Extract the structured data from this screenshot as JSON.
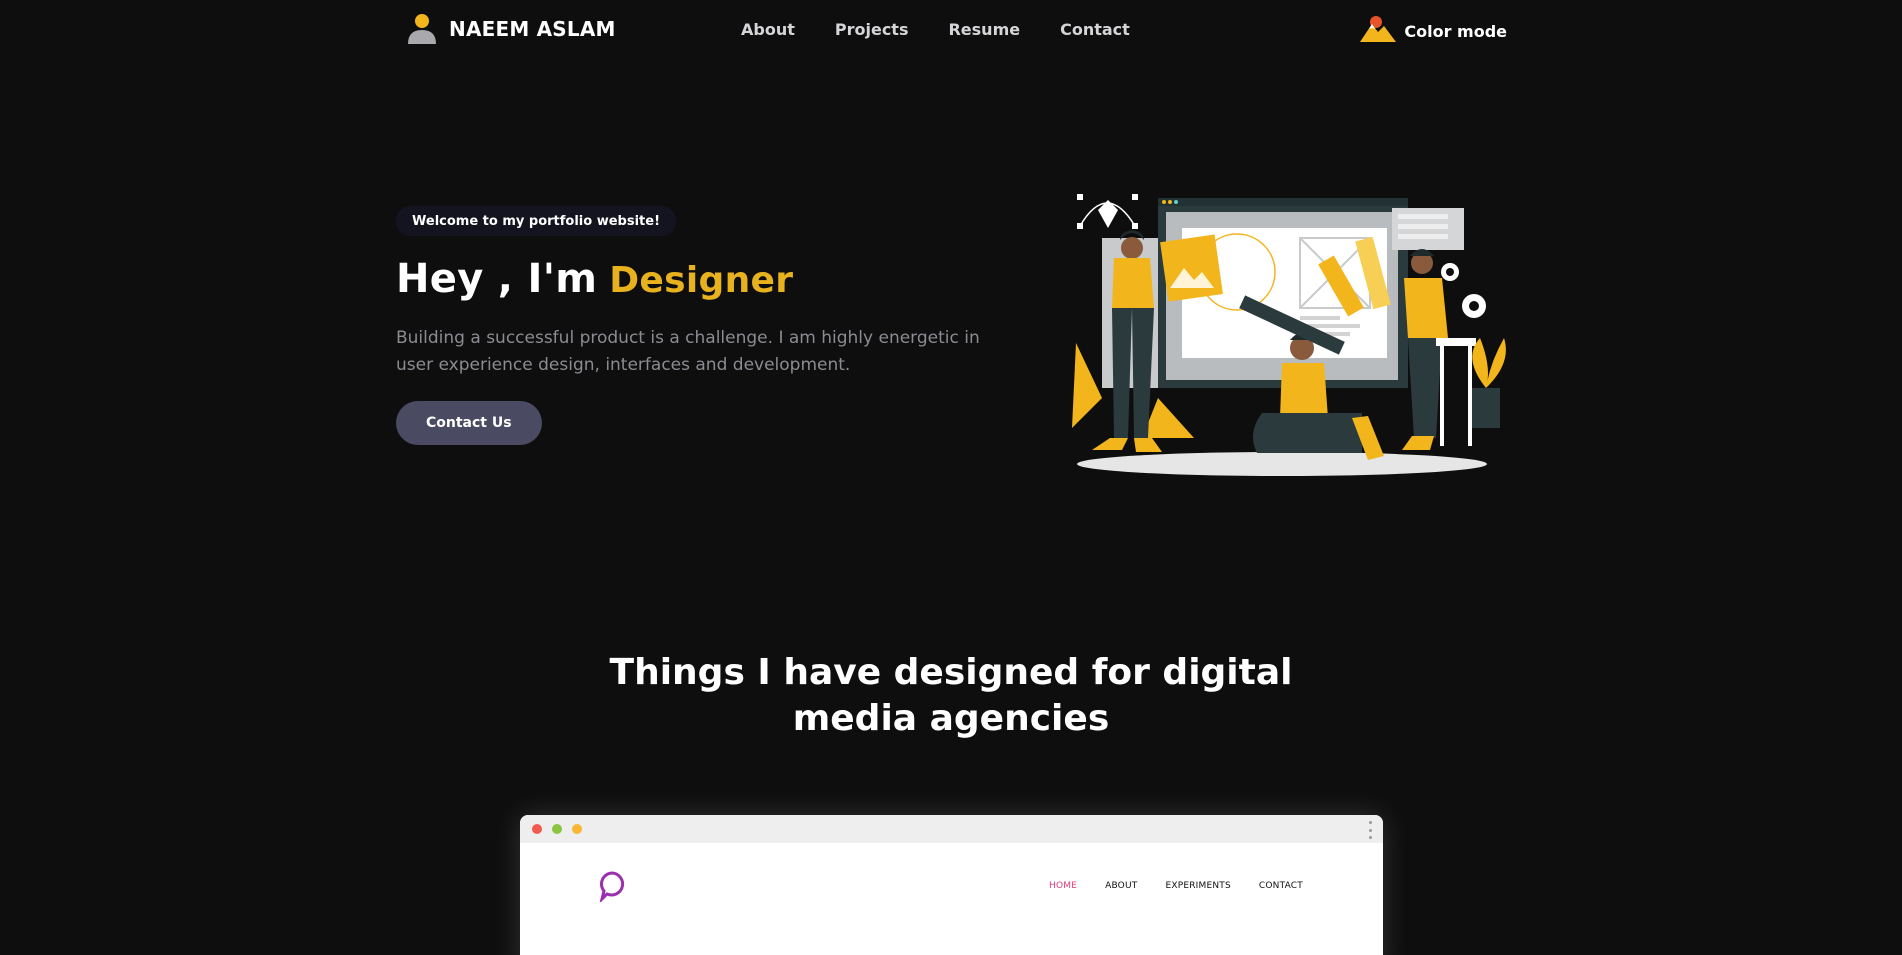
{
  "header": {
    "brand_name": "NAEEM ASLAM",
    "brand_icon": "user-avatar-icon",
    "nav": [
      "About",
      "Projects",
      "Resume",
      "Contact"
    ],
    "color_mode_label": "Color mode",
    "color_mode_icon": "mountain-sun-icon"
  },
  "hero": {
    "welcome": "Welcome to my portfolio website!",
    "title_prefix": "Hey , I'm",
    "title_role": "Designer",
    "description": "Building a successful product is a challenge. I am highly energetic in user experience design, interfaces and development.",
    "cta_label": "Contact Us"
  },
  "section": {
    "title_line1": "Things I have designed for digital",
    "title_line2": "media agencies"
  },
  "mockup": {
    "nav": [
      "HOME",
      "ABOUT",
      "EXPERIMENTS",
      "CONTACT"
    ],
    "active_nav": "HOME"
  },
  "colors": {
    "background": "#0e0e0f",
    "accent": "#e8b21e",
    "button": "#4a4a62",
    "mockup_active": "#e23a7a"
  }
}
